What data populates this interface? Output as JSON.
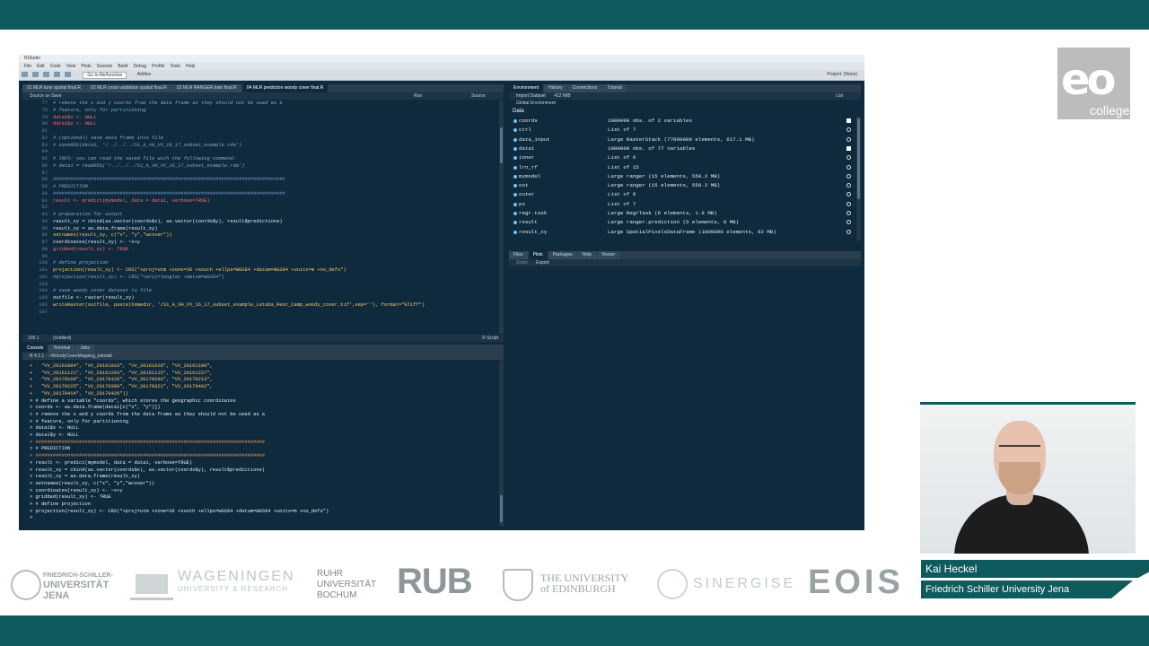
{
  "colors": {
    "brand_teal": "#0e5a5c",
    "ide_bg": "#0f2a3d",
    "comment": "#8aa7c9",
    "string": "#ffc86b",
    "keyword_true": "#ff6d6d"
  },
  "rstudio": {
    "window_title": "RStudio",
    "menu": [
      "File",
      "Edit",
      "Code",
      "View",
      "Plots",
      "Session",
      "Build",
      "Debug",
      "Profile",
      "Tools",
      "Help"
    ],
    "goto_placeholder": "Go to file/function",
    "addins": "Addins",
    "project": "Project: (None)",
    "source_tabs": [
      "01 MLR tune spatial final.R",
      "02 MLR cross validation spatial final.R",
      "03 MLR RANGER train final.R",
      "04 MLR prediction woody cover final.R"
    ],
    "source_on_save": "Source on Save",
    "run": "Run",
    "source_btn": "Source",
    "editor_lines": [
      {
        "n": "77",
        "t": "# remove the x and y coords from the data frame as they should not be used as a",
        "k": "comment"
      },
      {
        "n": "78",
        "t": "# feature, only for partitioning",
        "k": "comment"
      },
      {
        "n": "79",
        "t": "data1$x <- NULL",
        "k": "null"
      },
      {
        "n": "80",
        "t": "data1$y <- NULL",
        "k": "null"
      },
      {
        "n": "81",
        "t": "",
        "k": "plain"
      },
      {
        "n": "82",
        "t": "# (optional) save data frame into file",
        "k": "comment"
      },
      {
        "n": "83",
        "t": "# saveRDS(data1, '/../../../S1_A_VH_VV_16_17_subset_example.rda')",
        "k": "comment"
      },
      {
        "n": "84",
        "t": "",
        "k": "plain"
      },
      {
        "n": "85",
        "t": "# INFO: you can read the saved file with the following command:",
        "k": "comment"
      },
      {
        "n": "86",
        "t": "# data1 = readRDS('/../../../S1_A_VH_VV_16_17_subset_example.rda')",
        "k": "comment"
      },
      {
        "n": "87",
        "t": "",
        "k": "plain"
      },
      {
        "n": "88",
        "t": "################################################################################",
        "k": "hash"
      },
      {
        "n": "89",
        "t": "# PREDICTION",
        "k": "comment"
      },
      {
        "n": "90",
        "t": "################################################################################",
        "k": "hash"
      },
      {
        "n": "91",
        "t": "result <- predict(mymodel, data = data1, verbose=TRUE)",
        "k": "true"
      },
      {
        "n": "92",
        "t": "",
        "k": "plain"
      },
      {
        "n": "93",
        "t": "# preparation for output",
        "k": "comment"
      },
      {
        "n": "94",
        "t": "result_xy = cbind(as.vector(coords$x), as.vector(coords$y), result$predictions)",
        "k": "plain"
      },
      {
        "n": "95",
        "t": "result_xy = as.data.frame(result_xy)",
        "k": "plain"
      },
      {
        "n": "96",
        "t": "setnames(result_xy, c(\"x\", \"y\",\"wcover\"))",
        "k": "str"
      },
      {
        "n": "97",
        "t": "coordinates(result_xy) <- ~x+y",
        "k": "plain"
      },
      {
        "n": "98",
        "t": "gridded(result_xy) <- TRUE",
        "k": "true"
      },
      {
        "n": "99",
        "t": "",
        "k": "plain"
      },
      {
        "n": "100",
        "t": "# define projection",
        "k": "comment"
      },
      {
        "n": "101",
        "t": "projection(result_xy) <- CRS(\"+proj=utm +zone=36 +south +ellps=WGS84 +datum=WGS84 +units=m +no_defs\")",
        "k": "str"
      },
      {
        "n": "102",
        "t": "#projection(result_xy) <- CRS(\"+proj=longlat +datum=WGS84\")",
        "k": "comment"
      },
      {
        "n": "103",
        "t": "",
        "k": "plain"
      },
      {
        "n": "104",
        "t": "# save woody cover dataset to file",
        "k": "comment"
      },
      {
        "n": "105",
        "t": "outfile <- raster(result_xy)",
        "k": "plain"
      },
      {
        "n": "106",
        "t": "writeRaster(outfile, paste(homedir, '/S1_A_VH_VV_16_17_subset_example_Letaba_Rest_Camp_woody_cover.tif',sep=''), format=\"GTiff\")",
        "k": "str"
      },
      {
        "n": "107",
        "t": "",
        "k": "plain"
      }
    ],
    "editor_status_pos": "105:1",
    "editor_status_scope": "(Untitled)",
    "editor_status_type": "R Script",
    "console_tabs": [
      "Console",
      "Terminal",
      "Jobs"
    ],
    "console_path": "R 4.1.1 · ~/WoodyCoverMapping_tutorial/",
    "console_lines": [
      {
        "t": "+   \"VV_20161004\", \"VV_20161016\", \"VV_20161028\", \"VV_20161109\",",
        "k": "str"
      },
      {
        "t": "+   \"VV_20161121\", \"VV_20161203\", \"VV_20161215\", \"VV_20161227\",",
        "k": "str"
      },
      {
        "t": "+   \"VV_20170108\", \"VV_20170120\", \"VV_20170201\", \"VV_20170213\",",
        "k": "str"
      },
      {
        "t": "+   \"VV_20170225\", \"VV_20170309\", \"VV_20170321\", \"VV_20170402\",",
        "k": "str"
      },
      {
        "t": "+   \"VV_20170414\", \"VV_20170426\"))",
        "k": "str"
      },
      {
        "t": "> # define a variable \"coords\", which stores the geographic coordinates",
        "k": "plain"
      },
      {
        "t": "> coords <- as.data.frame(data1[c(\"x\", \"y\")])",
        "k": "plain"
      },
      {
        "t": "> # remove the x and y coords from the data frame as they should not be used as a",
        "k": "plain"
      },
      {
        "t": "> # feature, only for partitioning",
        "k": "plain"
      },
      {
        "t": "> data1$x <- NULL",
        "k": "plain"
      },
      {
        "t": "> data1$y <- NULL",
        "k": "plain"
      },
      {
        "t": "> ###############################################################################",
        "k": "hash"
      },
      {
        "t": "> # PREDICTION",
        "k": "plain"
      },
      {
        "t": "> ###############################################################################",
        "k": "hash"
      },
      {
        "t": "> result <- predict(mymodel, data = data1, verbose=TRUE)",
        "k": "plain"
      },
      {
        "t": "> result_xy = cbind(as.vector(coords$x), as.vector(coords$y), result$predictions)",
        "k": "plain"
      },
      {
        "t": "> result_xy = as.data.frame(result_xy)",
        "k": "plain"
      },
      {
        "t": "> setnames(result_xy, c(\"x\", \"y\",\"wcover\"))",
        "k": "plain"
      },
      {
        "t": "> coordinates(result_xy) <- ~x+y",
        "k": "plain"
      },
      {
        "t": "> gridded(result_xy) <- TRUE",
        "k": "plain"
      },
      {
        "t": "> # define projection",
        "k": "plain"
      },
      {
        "t": "> projection(result_xy) <- CRS(\"+proj=utm +zone=36 +south +ellps=WGS84 +datum=WGS84 +units=m +no_defs\")",
        "k": "plain"
      },
      {
        "t": ">",
        "k": "plain"
      }
    ],
    "env_tabs": [
      "Environment",
      "History",
      "Connections",
      "Tutorial"
    ],
    "env_import": "Import Dataset",
    "env_memory": "412 MiB",
    "env_list": "List",
    "env_scope": "Global Environment",
    "env_section": "Data",
    "env_rows": [
      {
        "name": "coords",
        "value": "1000000 obs. of 2 variables",
        "act": "square"
      },
      {
        "name": "ctrl",
        "value": "List of 7",
        "act": "mag"
      },
      {
        "name": "data_input",
        "value": "Large RasterStack (77000000 elements, 617.1 MB)",
        "act": "mag"
      },
      {
        "name": "data1",
        "value": "1000000 obs. of 77 variables",
        "act": "square"
      },
      {
        "name": "inner",
        "value": "List of 6",
        "act": "mag"
      },
      {
        "name": "lrn_rf",
        "value": "List of 15",
        "act": "mag"
      },
      {
        "name": "mymodel",
        "value": "Large ranger (15 elements, 550.2 MB)",
        "act": "mag"
      },
      {
        "name": "out",
        "value": "Large ranger (15 elements, 550.2 MB)",
        "act": "mag"
      },
      {
        "name": "outer",
        "value": "List of 8",
        "act": "mag"
      },
      {
        "name": "ps",
        "value": "List of 7",
        "act": "mag"
      },
      {
        "name": "regr.task",
        "value": "Large RegrTask (6 elements, 1.8 MB)",
        "act": "mag"
      },
      {
        "name": "result",
        "value": "Large ranger.prediction (5 elements, 8 MB)",
        "act": "mag"
      },
      {
        "name": "result_xy",
        "value": "Large SpatialPixelsDataFrame (1000000 elements, 92 MB)",
        "act": "mag"
      }
    ],
    "files_tabs": [
      "Files",
      "Plots",
      "Packages",
      "Help",
      "Viewer"
    ],
    "plots_zoom": "Zoom",
    "plots_export": "Export"
  },
  "presenter": {
    "name": "Kai Heckel",
    "affiliation": "Friedrich Schiller University Jena"
  },
  "logos": {
    "eo": "eo",
    "eo_sub": "college",
    "jena": [
      "FRIEDRICH-SCHILLER-",
      "UNIVERSITÄT",
      "JENA"
    ],
    "wageningen": [
      "WAGENINGEN",
      "UNIVERSITY & RESEARCH"
    ],
    "ruhr": [
      "RUHR",
      "UNIVERSITÄT",
      "BOCHUM"
    ],
    "rub": "RUB",
    "edinburgh": [
      "THE UNIVERSITY",
      "of EDINBURGH"
    ],
    "sinergise": "SINERGISE",
    "eois": "EOIS"
  }
}
